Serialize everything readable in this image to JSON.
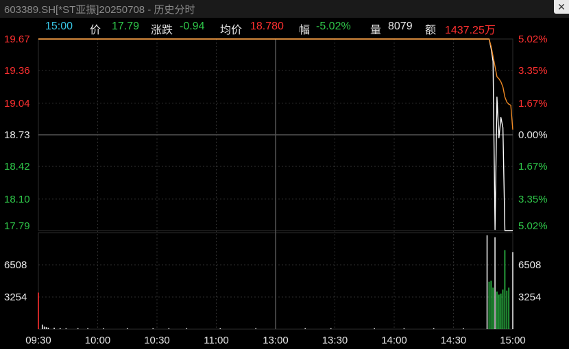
{
  "window": {
    "title": "603389.SH[*ST亚振]20250708 - 历史分时",
    "close_glyph": "✕"
  },
  "info": {
    "time": "15:00",
    "price_label": "价",
    "price": "17.79",
    "change_label": "涨跌",
    "change": "-0.94",
    "avg_label": "均价",
    "avg": "18.780",
    "pct_label": "幅",
    "pct": "-5.02%",
    "vol_label": "量",
    "vol": "8079",
    "amount_label": "额",
    "amount": "1437.25万"
  },
  "colors": {
    "up": "#ff3030",
    "down": "#2fc84a",
    "neutral": "#e6e6e6",
    "price_line": "#ffffff",
    "avg_line": "#f08a24",
    "grid": "#2e2e2e",
    "grid_major": "#555555"
  },
  "chart_data": {
    "type": "line",
    "price_axis": {
      "left_ticks": [
        "19.67",
        "19.36",
        "19.04",
        "18.73",
        "18.42",
        "18.10",
        "17.79"
      ],
      "right_ticks": [
        "5.02%",
        "3.35%",
        "1.67%",
        "0.00%",
        "1.67%",
        "3.35%",
        "5.02%"
      ],
      "tick_values": [
        19.67,
        19.36,
        19.04,
        18.73,
        18.42,
        18.1,
        17.79
      ],
      "tick_states": [
        "up",
        "up",
        "up",
        "neutral",
        "down",
        "down",
        "down"
      ],
      "ylim": [
        17.79,
        19.67
      ],
      "prev_close": 18.73
    },
    "volume_axis": {
      "ticks": [
        "6508",
        "3254"
      ],
      "tick_values": [
        6508,
        3254
      ],
      "ylim": [
        0,
        9762
      ]
    },
    "x_axis": {
      "ticks": [
        "09:30",
        "10:00",
        "10:30",
        "11:00",
        "13:00",
        "13:30",
        "14:00",
        "14:30",
        "15:00"
      ],
      "minutes": [
        0,
        30,
        60,
        90,
        120,
        150,
        180,
        210,
        240
      ],
      "xlim": [
        0,
        240
      ]
    },
    "series": [
      {
        "key": "price",
        "x": [
          0,
          228,
          229,
          230,
          231,
          232,
          233,
          234,
          235,
          236,
          237,
          238,
          239,
          240
        ],
        "values": [
          19.67,
          19.67,
          19.58,
          19.45,
          17.8,
          19.1,
          18.7,
          18.9,
          18.8,
          17.79,
          17.79,
          17.79,
          17.79,
          17.79
        ]
      },
      {
        "key": "avg",
        "x": [
          0,
          228,
          229,
          230,
          231,
          232,
          233,
          234,
          235,
          236,
          237,
          238,
          239,
          240
        ],
        "values": [
          19.67,
          19.67,
          19.6,
          19.5,
          19.4,
          19.3,
          19.28,
          19.25,
          19.2,
          19.1,
          19.05,
          19.03,
          19.02,
          18.78
        ]
      }
    ],
    "volume_bars": [
      {
        "x": 0,
        "v": 3700,
        "state": "up"
      },
      {
        "x": 2,
        "v": 450,
        "state": "neutral"
      },
      {
        "x": 3,
        "v": 250,
        "state": "neutral"
      },
      {
        "x": 4,
        "v": 200,
        "state": "neutral"
      },
      {
        "x": 5,
        "v": 150,
        "state": "neutral"
      },
      {
        "x": 8,
        "v": 150,
        "state": "neutral"
      },
      {
        "x": 11,
        "v": 120,
        "state": "neutral"
      },
      {
        "x": 14,
        "v": 100,
        "state": "neutral"
      },
      {
        "x": 20,
        "v": 100,
        "state": "neutral"
      },
      {
        "x": 25,
        "v": 100,
        "state": "neutral"
      },
      {
        "x": 33,
        "v": 100,
        "state": "neutral"
      },
      {
        "x": 45,
        "v": 100,
        "state": "neutral"
      },
      {
        "x": 58,
        "v": 100,
        "state": "neutral"
      },
      {
        "x": 66,
        "v": 100,
        "state": "neutral"
      },
      {
        "x": 75,
        "v": 100,
        "state": "neutral"
      },
      {
        "x": 92,
        "v": 100,
        "state": "neutral"
      },
      {
        "x": 110,
        "v": 100,
        "state": "neutral"
      },
      {
        "x": 135,
        "v": 100,
        "state": "neutral"
      },
      {
        "x": 148,
        "v": 100,
        "state": "neutral"
      },
      {
        "x": 170,
        "v": 100,
        "state": "neutral"
      },
      {
        "x": 185,
        "v": 100,
        "state": "neutral"
      },
      {
        "x": 200,
        "v": 100,
        "state": "neutral"
      },
      {
        "x": 215,
        "v": 100,
        "state": "neutral"
      },
      {
        "x": 227,
        "v": 9500,
        "state": "neutral"
      },
      {
        "x": 228,
        "v": 4800,
        "state": "down"
      },
      {
        "x": 229,
        "v": 4900,
        "state": "down"
      },
      {
        "x": 230,
        "v": 4200,
        "state": "down"
      },
      {
        "x": 231,
        "v": 9300,
        "state": "neutral"
      },
      {
        "x": 232,
        "v": 3800,
        "state": "down"
      },
      {
        "x": 233,
        "v": 3500,
        "state": "down"
      },
      {
        "x": 234,
        "v": 3600,
        "state": "down"
      },
      {
        "x": 235,
        "v": 4000,
        "state": "down"
      },
      {
        "x": 236,
        "v": 8000,
        "state": "down"
      },
      {
        "x": 237,
        "v": 3900,
        "state": "down"
      },
      {
        "x": 238,
        "v": 4200,
        "state": "down"
      },
      {
        "x": 240,
        "v": 7800,
        "state": "neutral"
      }
    ]
  }
}
